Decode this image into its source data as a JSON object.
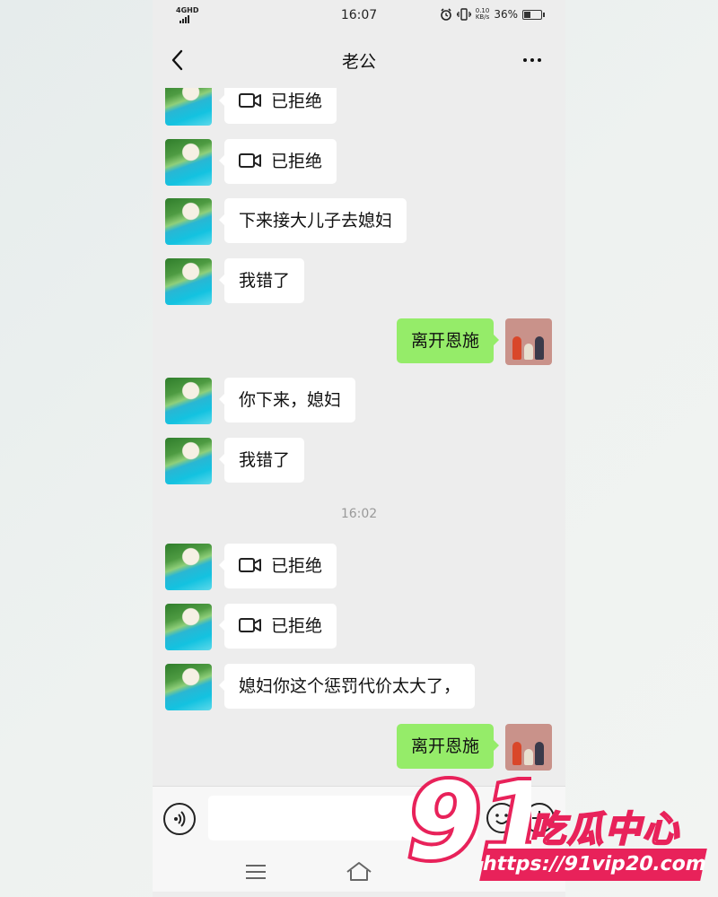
{
  "status_bar": {
    "network": "4GHD",
    "time": "16:07",
    "speed_value": "0.10",
    "speed_unit": "KB/s",
    "battery": "36%"
  },
  "header": {
    "title": "老公",
    "back_icon": "chevron-left-icon",
    "more_icon": "more-dots-icon"
  },
  "messages": [
    {
      "side": "in",
      "type": "video_call",
      "text": "已拒绝"
    },
    {
      "side": "in",
      "type": "video_call",
      "text": "已拒绝"
    },
    {
      "side": "in",
      "type": "text",
      "text": "下来接大儿子去媳妇"
    },
    {
      "side": "in",
      "type": "text",
      "text": "我错了"
    },
    {
      "side": "out",
      "type": "text",
      "text": "离开恩施"
    },
    {
      "side": "in",
      "type": "text",
      "text": "你下来，媳妇"
    },
    {
      "side": "in",
      "type": "text",
      "text": "我错了"
    },
    {
      "type": "timestamp",
      "text": "16:02"
    },
    {
      "side": "in",
      "type": "video_call",
      "text": "已拒绝"
    },
    {
      "side": "in",
      "type": "video_call",
      "text": "已拒绝"
    },
    {
      "side": "in",
      "type": "text",
      "text": "媳妇你这个惩罚代价太大了，"
    },
    {
      "side": "out",
      "type": "text",
      "text": "离开恩施"
    }
  ],
  "input_bar": {
    "voice_icon": "voice-icon",
    "emoji_icon": "emoji-icon",
    "plus_icon": "plus-icon"
  },
  "watermark": {
    "number": "91",
    "name": "吃瓜中心",
    "url": "https://91vip20.com"
  },
  "colors": {
    "chat_bg": "#ededed",
    "outgoing_bubble": "#95ec69",
    "incoming_bubble": "#ffffff",
    "watermark_accent": "#e8225a"
  }
}
